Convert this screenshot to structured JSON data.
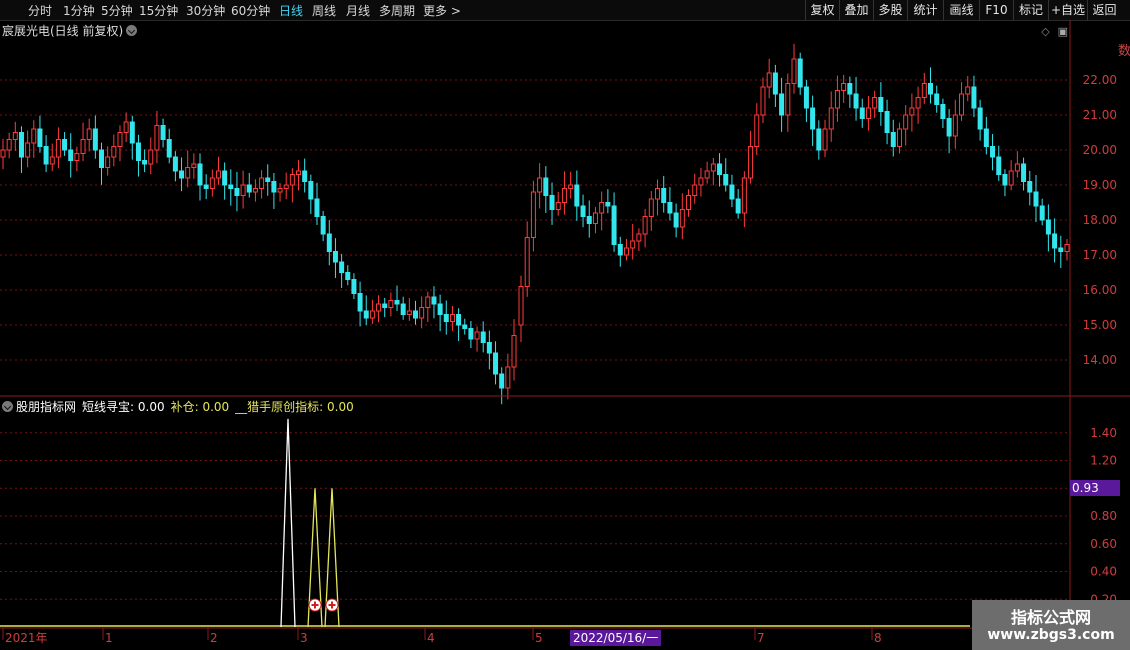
{
  "toolbar": {
    "periods": [
      "分时",
      "1分钟",
      "5分钟",
      "15分钟",
      "30分钟",
      "60分钟",
      "日线",
      "周线",
      "月线",
      "多周期",
      "更多 >"
    ],
    "active_period": "日线",
    "right_buttons": [
      "复权",
      "叠加",
      "多股",
      "统计",
      "画线",
      "F10",
      "标记",
      "+自选",
      "返回"
    ]
  },
  "stock": {
    "title": "宸展光电(日线 前复权)"
  },
  "indicator": {
    "name": "股朋指标网",
    "line1": "短线寻宝: 0.00",
    "line2": "补仓: 0.00",
    "line3": "__猎手原创指标: 0.00"
  },
  "price_axis": {
    "labels": [
      "22.00",
      "21.00",
      "20.00",
      "19.00",
      "18.00",
      "17.00",
      "16.00",
      "15.00",
      "14.00"
    ]
  },
  "ind_axis": {
    "labels": [
      "1.40",
      "1.20",
      "0.80",
      "0.60",
      "0.40",
      "0.20"
    ],
    "current_value": "0.93"
  },
  "date_axis": {
    "labels": [
      "2021年",
      "1",
      "2",
      "3",
      "4",
      "5",
      "7",
      "8"
    ],
    "cursor_date": "2022/05/16/一"
  },
  "watermark": {
    "line1": "指标公式网",
    "line2": "www.zbgs3.com"
  },
  "colors": {
    "up": "#ff3b3b",
    "down": "#33e6ee",
    "grid": "#7a1010",
    "white_line": "#ffffff",
    "yellow_line": "#e6e65a"
  },
  "chart_data": [
    {
      "type": "candlestick",
      "title": "宸展光电(日线 前复权)",
      "ylim": [
        13.0,
        23.2
      ],
      "y_ticks": [
        14.0,
        15.0,
        16.0,
        17.0,
        18.0,
        19.0,
        20.0,
        21.0,
        22.0
      ],
      "segments_close": [
        {
          "from": "2021-01",
          "close": [
            20.0,
            20.3,
            20.5,
            19.8,
            20.2,
            20.6,
            20.1,
            19.6,
            19.8,
            20.3,
            20.0,
            19.7,
            19.9,
            20.3,
            20.6,
            20.0,
            19.5,
            19.8,
            20.1,
            20.5,
            20.8,
            20.2,
            19.7,
            19.6,
            20.0,
            20.7,
            20.3,
            19.8,
            19.4,
            19.2,
            19.5,
            19.6,
            19.0,
            18.9,
            19.2,
            19.4,
            19.0,
            18.9,
            18.7,
            19.0,
            18.8,
            18.9,
            19.2,
            19.1,
            18.8,
            18.9,
            19.0,
            19.3,
            19.4,
            19.1,
            18.6,
            18.1,
            17.6,
            17.1,
            16.8,
            16.5,
            16.3,
            15.9,
            15.4,
            15.2,
            15.4,
            15.6,
            15.5,
            15.7,
            15.6,
            15.3,
            15.4,
            15.2,
            15.5,
            15.8,
            15.6,
            15.3,
            15.1,
            15.3,
            15.0,
            14.9,
            14.6,
            14.8,
            14.5,
            14.2,
            13.6,
            13.2,
            13.8,
            14.7
          ]
        },
        {
          "from": "2022-05-16",
          "close": [
            16.1,
            17.5,
            18.8,
            19.2,
            18.7,
            18.3,
            18.5,
            18.9,
            19.0,
            18.4,
            18.1,
            17.9,
            18.2,
            18.5,
            18.4,
            17.3,
            17.0,
            17.2,
            17.4,
            17.6,
            18.1,
            18.6,
            18.9,
            18.5,
            18.2,
            17.8,
            18.3,
            18.7,
            19.0,
            19.2,
            19.4,
            19.6,
            19.3,
            19.0,
            18.6,
            18.2,
            19.2,
            20.1,
            21.0,
            21.8,
            22.2,
            21.6,
            21.0,
            21.9,
            22.6,
            21.8,
            21.2,
            20.6,
            20.0,
            20.6,
            21.2,
            21.7,
            21.9,
            21.6,
            21.2,
            20.9,
            21.2,
            21.5,
            21.1,
            20.5,
            20.1,
            20.6,
            21.0,
            21.2,
            21.5,
            21.9,
            21.6,
            21.3,
            20.9,
            20.4,
            21.0,
            21.6,
            21.8,
            21.2,
            20.6,
            20.1,
            19.8,
            19.3,
            19.0,
            19.4,
            19.6,
            19.1,
            18.8,
            18.4,
            18.0,
            17.6,
            17.2,
            17.1,
            17.3
          ]
        }
      ]
    },
    {
      "type": "line",
      "title": "股朋指标网",
      "ylim": [
        0,
        1.55
      ],
      "series": [
        {
          "name": "短线寻宝",
          "color": "#ffffff",
          "spikes": [
            {
              "at": "2021-03",
              "value": 1.5
            }
          ]
        },
        {
          "name": "补仓",
          "color": "#e6e65a",
          "spikes": [
            {
              "at": "2021-03",
              "value": 1.0
            },
            {
              "at": "2021-03",
              "value": 1.0
            }
          ]
        }
      ]
    }
  ]
}
